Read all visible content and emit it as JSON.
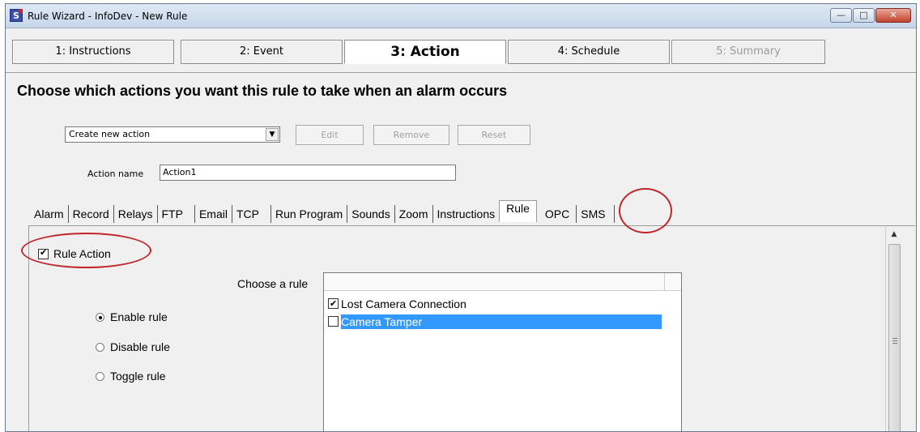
{
  "window": {
    "title": "Rule Wizard - InfoDev - New Rule",
    "controls": {
      "minimize": "—",
      "maximize": "□",
      "close": "✕"
    }
  },
  "steps": [
    {
      "label": "1: Instructions",
      "state": "normal"
    },
    {
      "label": "2: Event",
      "state": "normal"
    },
    {
      "label": "3: Action",
      "state": "active"
    },
    {
      "label": "4: Schedule",
      "state": "normal"
    },
    {
      "label": "5: Summary",
      "state": "disabled"
    }
  ],
  "main": {
    "heading": "Choose which actions you want this rule to take when an alarm occurs",
    "action_select": {
      "value": "Create new action",
      "arrow_icon": "dropdown-arrow-icon"
    },
    "buttons": {
      "edit": "Edit",
      "remove": "Remove",
      "reset": "Reset"
    },
    "action_name": {
      "label": "Action name",
      "value": "Action1"
    }
  },
  "tabs": [
    "Alarm",
    "Record",
    "Relays",
    "FTP",
    "Email",
    "TCP",
    "Run Program",
    "Sounds",
    "Zoom",
    "Instructions",
    "Rule",
    "OPC",
    "SMS"
  ],
  "active_tab": "Rule",
  "rule_panel": {
    "rule_action": {
      "label": "Rule Action",
      "checked": true
    },
    "choose_label": "Choose a rule",
    "mode_options": [
      {
        "label": "Enable rule",
        "selected": true
      },
      {
        "label": "Disable rule",
        "selected": false
      },
      {
        "label": "Toggle rule",
        "selected": false
      }
    ],
    "rules": [
      {
        "name": "Lost Camera Connection",
        "checked": true,
        "selected": false
      },
      {
        "name": "Camera Tamper",
        "checked": false,
        "selected": true
      }
    ]
  },
  "colors": {
    "annotation": "#c0282a",
    "selection": "#3399ff"
  }
}
